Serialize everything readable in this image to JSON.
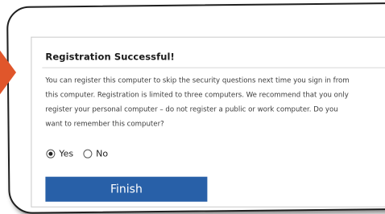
{
  "dialog": {
    "title": "Registration Successful!",
    "message_lines": [
      "You can register this computer to skip the security questions next time you sign in from",
      "this computer. Registration is limited to three computers. We recommend that you only",
      "register your personal computer – do not register a public or work computer. Do you",
      "want to remember this computer?"
    ],
    "options": [
      {
        "label": "Yes",
        "selected": true
      },
      {
        "label": "No",
        "selected": false
      }
    ],
    "finish_label": "Finish"
  },
  "colors": {
    "accent_arrow": "#e0562b",
    "button_bg": "#2860a8"
  },
  "icons": {
    "pointer": "arrow-right-icon",
    "radio": "radio-icon"
  }
}
